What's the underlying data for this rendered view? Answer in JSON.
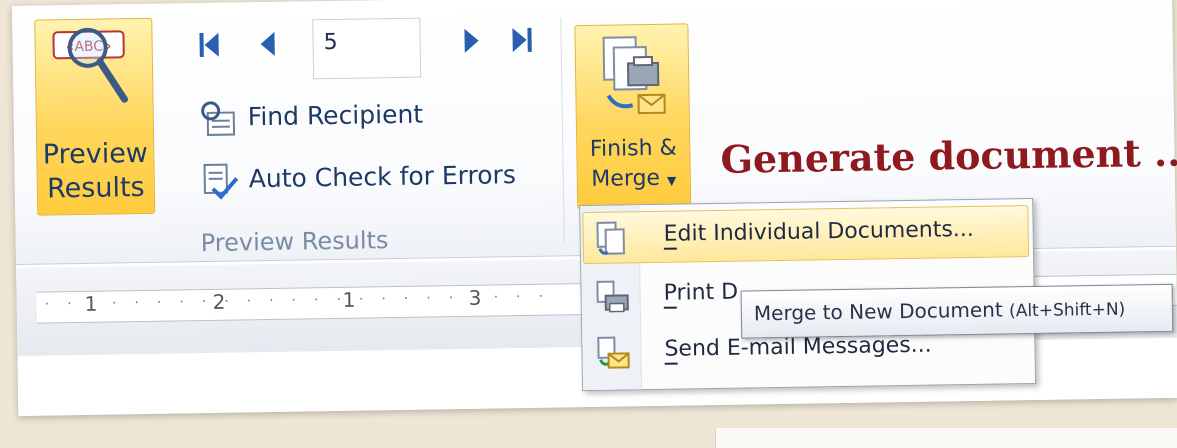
{
  "ribbon": {
    "preview_button": {
      "line1": "Preview",
      "line2": "Results",
      "icon": "abc-magnifier-icon"
    },
    "record_number": "5",
    "nav_icons": [
      "first-record-icon",
      "previous-record-icon",
      "next-record-icon",
      "last-record-icon"
    ],
    "find_recipient": {
      "label": "Find Recipient",
      "icon": "address-book-icon"
    },
    "auto_check": {
      "label": "Auto Check for Errors",
      "icon": "check-document-icon"
    },
    "group_label": "Preview Results",
    "finish_button": {
      "line1": "Finish &",
      "line2": "Merge",
      "icon": "merge-documents-icon"
    }
  },
  "headline": "Generate document ...",
  "ruler": {
    "numbers": [
      "1",
      "2",
      "1",
      "3"
    ]
  },
  "menu": {
    "items": [
      {
        "label": "Edit Individual Documents...",
        "accel": "E",
        "icon": "edit-documents-icon",
        "highlighted": true
      },
      {
        "label": "Print D",
        "accel": "P",
        "icon": "print-documents-icon",
        "highlighted": false
      },
      {
        "label": "Send E-mail Messages...",
        "accel": "S",
        "icon": "email-messages-icon",
        "highlighted": false
      }
    ]
  },
  "tooltip": {
    "text": "Merge to New Document",
    "shortcut": "(Alt+Shift+N)"
  },
  "colors": {
    "accent_gold": "#ffd65c",
    "headline_red": "#8e1a1f",
    "ribbon_text": "#1d3a66"
  }
}
